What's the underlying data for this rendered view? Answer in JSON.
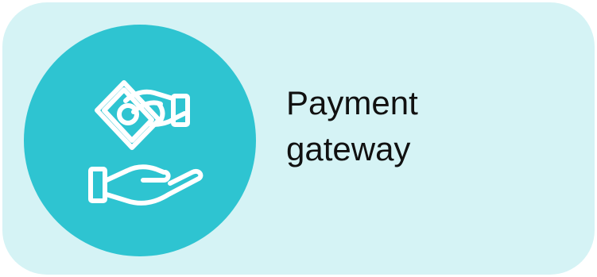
{
  "card": {
    "title": "Payment\ngateway",
    "icon": "hand-giving-money-icon",
    "colors": {
      "card_background": "#d5f3f5",
      "badge_background": "#2ec4d1",
      "icon_stroke": "#ffffff",
      "text": "#111111"
    }
  }
}
